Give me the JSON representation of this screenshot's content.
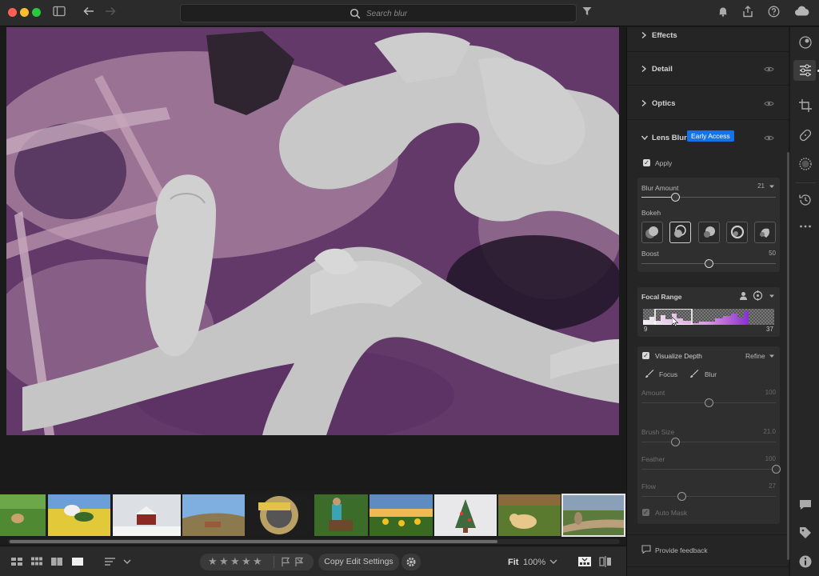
{
  "search": {
    "placeholder": "Search blur"
  },
  "panel": {
    "sections": [
      {
        "title": "Effects"
      },
      {
        "title": "Detail"
      },
      {
        "title": "Optics"
      },
      {
        "title": "Lens Blur",
        "badge": "Early Access"
      }
    ],
    "apply_label": "Apply",
    "blur_amount": {
      "label": "Blur Amount",
      "value": "21",
      "position": 0.25
    },
    "bokeh_label": "Bokeh",
    "boost": {
      "label": "Boost",
      "value": "50",
      "position": 0.5
    },
    "focal_range": {
      "label": "Focal Range",
      "min": "9",
      "max": "37"
    },
    "visualize_depth_label": "Visualize Depth",
    "refine_label": "Refine",
    "focus_label": "Focus",
    "blur_label": "Blur",
    "amount": {
      "label": "Amount",
      "value": "100",
      "position": 0.5
    },
    "brush_size": {
      "label": "Brush Size",
      "value": "21.0",
      "position": 0.25
    },
    "feather": {
      "label": "Feather",
      "value": "100",
      "position": 1.0
    },
    "flow": {
      "label": "Flow",
      "value": "27",
      "position": 0.3
    },
    "auto_mask_label": "Auto Mask",
    "feedback_label": "Provide feedback"
  },
  "bottom": {
    "copy_edit_label": "Copy Edit Settings",
    "fit_label": "Fit",
    "zoom_label": "100%"
  },
  "colors": {
    "accent": "#1473e6",
    "mask_purple": "#6a3d6c",
    "panel_bg": "#252525"
  }
}
